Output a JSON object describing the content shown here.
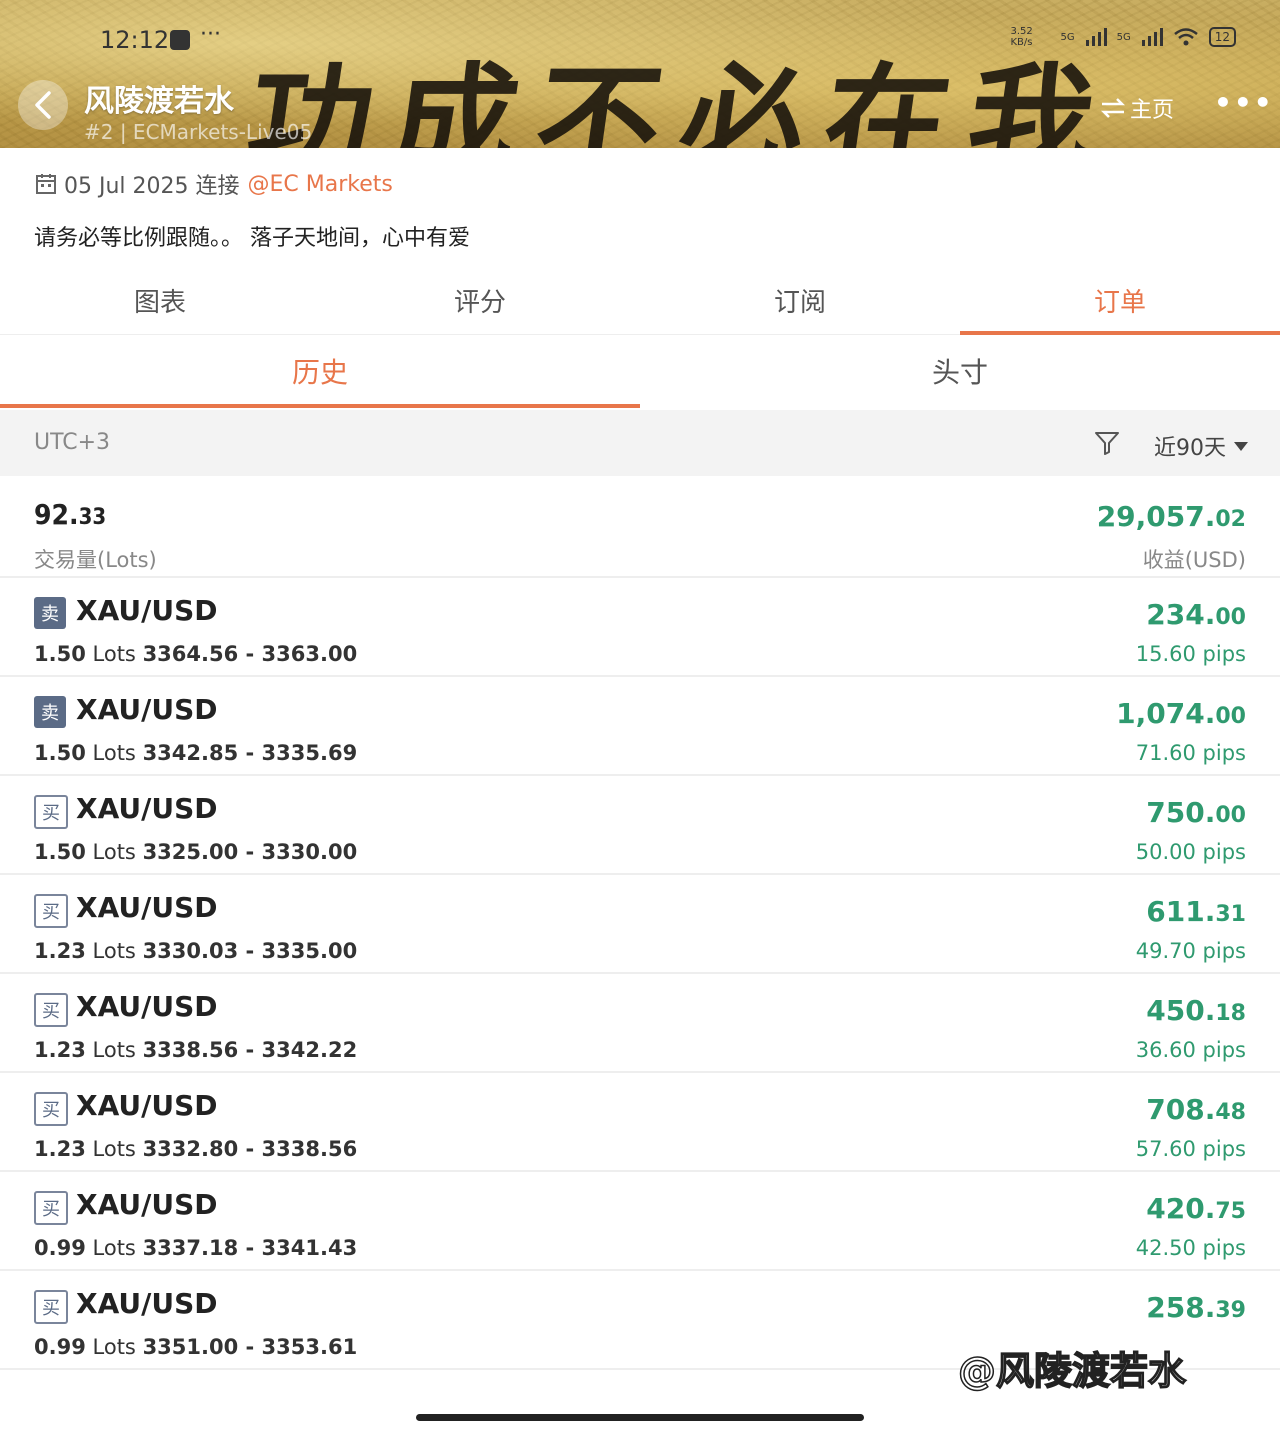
{
  "status_bar": {
    "time": "12:12",
    "dots": "···",
    "net_speed": "3.52 KB/s",
    "signal1": "5G",
    "signal2": "5G",
    "battery": "12"
  },
  "header": {
    "banner_calligraphy": "功成不必在我",
    "author_name": "风陵渡若水",
    "author_sub": "#2 | ECMarkets-Live05",
    "home_label": "主页",
    "more_label": "•••"
  },
  "info": {
    "date_connect": "05 Jul 2025 连接",
    "broker_link": "@EC Markets",
    "description": "请务必等比例跟随。。 落子天地间，心中有爱"
  },
  "tabs": [
    {
      "label": "图表",
      "active": false
    },
    {
      "label": "评分",
      "active": false
    },
    {
      "label": "订阅",
      "active": false
    },
    {
      "label": "订单",
      "active": true
    }
  ],
  "subtabs": [
    {
      "label": "历史",
      "active": true
    },
    {
      "label": "头寸",
      "active": false
    }
  ],
  "filter": {
    "timezone": "UTC+3",
    "range": "近90天"
  },
  "summary": {
    "lots_int": "92.",
    "lots_dec": "33",
    "lots_label": "交易量(Lots)",
    "profit_int": "29,057.",
    "profit_dec": "02",
    "profit_label": "收益(USD)"
  },
  "orders": [
    {
      "side": "卖",
      "type": "sell",
      "symbol": "XAU/USD",
      "lots": "1.50",
      "lots_unit": "Lots",
      "prices": "3364.56 - 3363.00",
      "profit_int": "234.",
      "profit_dec": "00",
      "pips": "15.60 pips"
    },
    {
      "side": "卖",
      "type": "sell",
      "symbol": "XAU/USD",
      "lots": "1.50",
      "lots_unit": "Lots",
      "prices": "3342.85 - 3335.69",
      "profit_int": "1,074.",
      "profit_dec": "00",
      "pips": "71.60 pips"
    },
    {
      "side": "买",
      "type": "buy",
      "symbol": "XAU/USD",
      "lots": "1.50",
      "lots_unit": "Lots",
      "prices": "3325.00 - 3330.00",
      "profit_int": "750.",
      "profit_dec": "00",
      "pips": "50.00 pips"
    },
    {
      "side": "买",
      "type": "buy",
      "symbol": "XAU/USD",
      "lots": "1.23",
      "lots_unit": "Lots",
      "prices": "3330.03 - 3335.00",
      "profit_int": "611.",
      "profit_dec": "31",
      "pips": "49.70 pips"
    },
    {
      "side": "买",
      "type": "buy",
      "symbol": "XAU/USD",
      "lots": "1.23",
      "lots_unit": "Lots",
      "prices": "3338.56 - 3342.22",
      "profit_int": "450.",
      "profit_dec": "18",
      "pips": "36.60 pips"
    },
    {
      "side": "买",
      "type": "buy",
      "symbol": "XAU/USD",
      "lots": "1.23",
      "lots_unit": "Lots",
      "prices": "3332.80 - 3338.56",
      "profit_int": "708.",
      "profit_dec": "48",
      "pips": "57.60 pips"
    },
    {
      "side": "买",
      "type": "buy",
      "symbol": "XAU/USD",
      "lots": "0.99",
      "lots_unit": "Lots",
      "prices": "3337.18 - 3341.43",
      "profit_int": "420.",
      "profit_dec": "75",
      "pips": "42.50 pips"
    },
    {
      "side": "买",
      "type": "buy",
      "symbol": "XAU/USD",
      "lots": "0.99",
      "lots_unit": "Lots",
      "prices": "3351.00 - 3353.61",
      "profit_int": "258.",
      "profit_dec": "39",
      "pips": ""
    }
  ],
  "watermark": "@风陵渡若水",
  "colors": {
    "accent": "#e8764a",
    "profit_green": "#2f9a6f",
    "sell_badge": "#5b6b86"
  }
}
